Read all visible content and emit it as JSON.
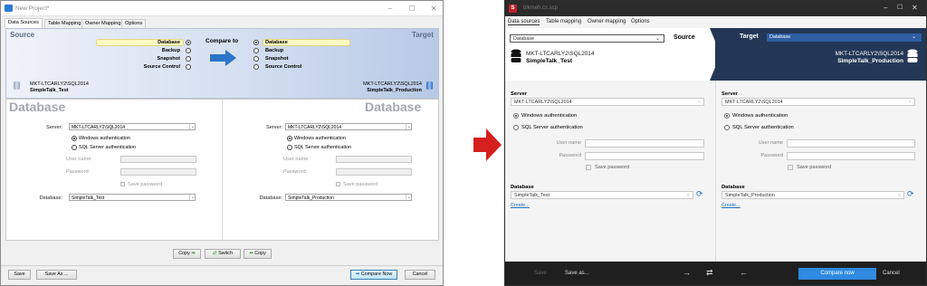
{
  "old": {
    "title": "New Project*",
    "tabs": [
      {
        "label": "Data Sources"
      },
      {
        "label": "Table Mapping"
      },
      {
        "label": "Owner Mapping"
      },
      {
        "label": "Options"
      }
    ],
    "source_header": "Source",
    "target_header": "Target",
    "compare_to": "Compare to",
    "source_options": [
      {
        "label": "Database",
        "selected": true
      },
      {
        "label": "Backup",
        "selected": false
      },
      {
        "label": "Snapshot",
        "selected": false
      },
      {
        "label": "Source Control",
        "selected": false
      }
    ],
    "target_options": [
      {
        "label": "Database",
        "selected": true
      },
      {
        "label": "Backup",
        "selected": false
      },
      {
        "label": "Snapshot",
        "selected": false
      },
      {
        "label": "Source Control",
        "selected": false
      }
    ],
    "source_server": "MKT-LTCARLY2\\SQL2014",
    "source_db": "SimpleTalk_Test",
    "target_server": "MKT-LTCARLY2\\SQL2014",
    "target_db": "SimpleTalk_Production",
    "db_heading": "Database",
    "server_label": "Server:",
    "win_auth": "Windows authentication",
    "sql_auth": "SQL Server authentication",
    "user_label": "User name:",
    "pass_label": "Password:",
    "save_password": "Save password",
    "database_label": "Database:",
    "copy_left": "Copy",
    "switch": "Switch",
    "copy_right": "Copy",
    "save": "Save",
    "save_as": "Save As ...",
    "compare_now": "Compare Now",
    "cancel": "Cancel"
  },
  "new": {
    "title": "blkmeh.cs.scp",
    "tabs": [
      {
        "label": "Data sources"
      },
      {
        "label": "Table mapping"
      },
      {
        "label": "Owner mapping"
      },
      {
        "label": "Options"
      }
    ],
    "source_type": "Database",
    "source_label": "Source",
    "target_label": "Target",
    "target_type": "Database",
    "source_server": "MKT-LTCARLY2\\SQL2014",
    "source_db": "SimpleTalk_Test",
    "target_server": "MKT-LTCARLY2\\SQL2014",
    "target_db": "SimpleTalk_Production",
    "server_heading": "Server",
    "win_auth": "Windows authentication",
    "sql_auth": "SQL Server authentication",
    "user_label": "User name",
    "pass_label": "Password",
    "save_password": "Save password",
    "database_heading": "Database",
    "create_link": "Create...",
    "save": "Save",
    "save_as": "Save as...",
    "compare_now": "Compare now",
    "cancel": "Cancel"
  },
  "colors": {
    "arrow": "#d61f1f",
    "target_band": "#243756",
    "compare_btn": "#2f8ae0"
  }
}
